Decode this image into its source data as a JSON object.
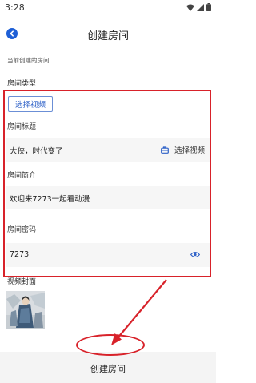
{
  "status_bar": {
    "time": "3:28"
  },
  "header": {
    "title": "创建房间",
    "back_icon": "chevron-left-icon"
  },
  "form": {
    "current_room_label": "当前创建的房间",
    "room_type_label": "房间类型",
    "select_video_chip": "选择视频",
    "title_label": "房间标题",
    "title_value": "大侠，时代变了",
    "title_action_label": "选择视频",
    "title_action_icon": "briefcase-icon",
    "intro_label": "房间简介",
    "intro_value": "欢迎来7273一起看动漫",
    "password_label": "房间密码",
    "password_value": "7273",
    "password_icon": "eye-icon",
    "cover_label": "视频封面"
  },
  "footer": {
    "create_button": "创建房间"
  },
  "colors": {
    "accent": "#1e5fd6",
    "annotation": "#d8222a",
    "field_bg": "#f6f6f6"
  }
}
